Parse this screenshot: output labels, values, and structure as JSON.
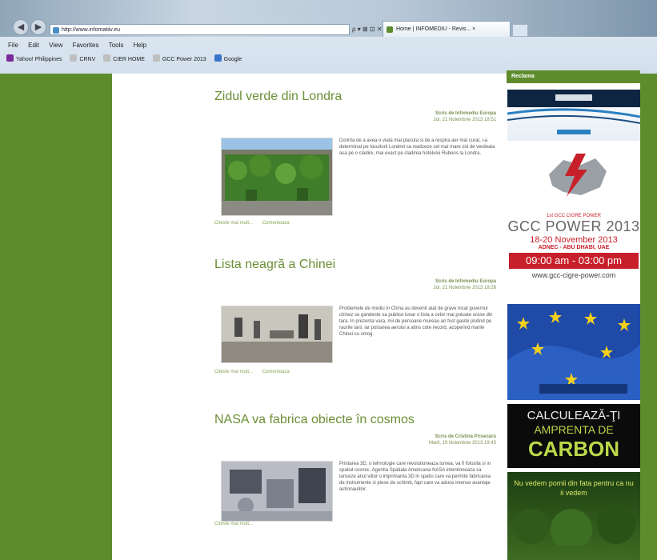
{
  "browser": {
    "url": "http://www.infomatiiv.eu",
    "address_tools": "ρ ▾ ⊠ ⊡ ✕",
    "tab_title": "Home | INFOMEDIU - Revis... ×",
    "back_glyph": "◀",
    "forward_glyph": "▶",
    "menu": [
      "File",
      "Edit",
      "View",
      "Favorites",
      "Tools",
      "Help"
    ],
    "favorites": [
      "Yahoo! Philippines",
      "CRNV",
      "CIER HOME",
      "GCC Power 2013",
      "Google"
    ]
  },
  "sidebar": {
    "heading": "Reclama"
  },
  "articles": [
    {
      "title": "Zidul verde din Londra",
      "author": "Scris de Infomediu Europa",
      "date": "Joi, 21 Noiembrie 2013 18:51",
      "text": "Dorinta de a avea o viata mai placuta si de a respira aer mai curat, i-a determinat pe locuitorii Londrei sa realizeze cel mai mare zid de verdeata asa pe o cladire, mai exact pe cladirea hotelului Rubens la Londra.",
      "links": [
        "Citeste mai mult...",
        "Comenteaza"
      ]
    },
    {
      "title": "Lista neagră a Chinei",
      "author": "Scris de Infomediu Europa",
      "date": "Joi, 21 Noiembrie 2013 18:28",
      "text": "Problemele de mediu in China au devenit atat de grave incat guvernul chinez se gandeste sa publice lunar o lista a celor mai poluate orase din tara. In prezenta vara, mii de persoane mureau an fost gasite plutind pe raurile tarii, iar poluarea aerului a atins cote record, acoperind marile Chinei cu smog.",
      "links": [
        "Citeste mai mult...",
        "Comenteaza"
      ]
    },
    {
      "title": "NASA va fabrica obiecte în cosmos",
      "author": "Scris de Cristina Prisecaru",
      "date": "Marti, 19 Noiembrie 2013 19:43",
      "text": "Printarea 3D, o tehnologie care revolutioneaza lumea, va fi folosita si in spatiul cosmic. Agentia Spatiala Americana NASA intentioneaza sa lanseze anul viitor o imprimanta 3D in spatiu care va permite fabricarea de instrumente si piese de schimb, fapt care va aduce imense avantaje astronautilor.",
      "links": [
        "Citeste mai mult..."
      ]
    }
  ],
  "ads": {
    "gcc": {
      "subtitle": "1st GCC CIGRE POWER",
      "event": "GCC POWER 2013",
      "dates": "18-20 November 2013",
      "venue": "ADNEC - ABU DHABI, UAE",
      "time": "09:00 am - 03:00 pm",
      "website": "www.gcc-cigre-power.com"
    },
    "carbon": {
      "line1": "CALCULEAZĂ-ŢI",
      "line2": "AMPRENTA DE",
      "line3": "CARBON"
    },
    "forest": {
      "line1": "Nu vedem pomii din fata pentru ca nu ii vedem"
    }
  },
  "colors": {
    "brand_green": "#5e8c2c",
    "title_green": "#6b8f34",
    "gcc_red": "#c8202a",
    "eu_blue": "#1f4aa8"
  }
}
